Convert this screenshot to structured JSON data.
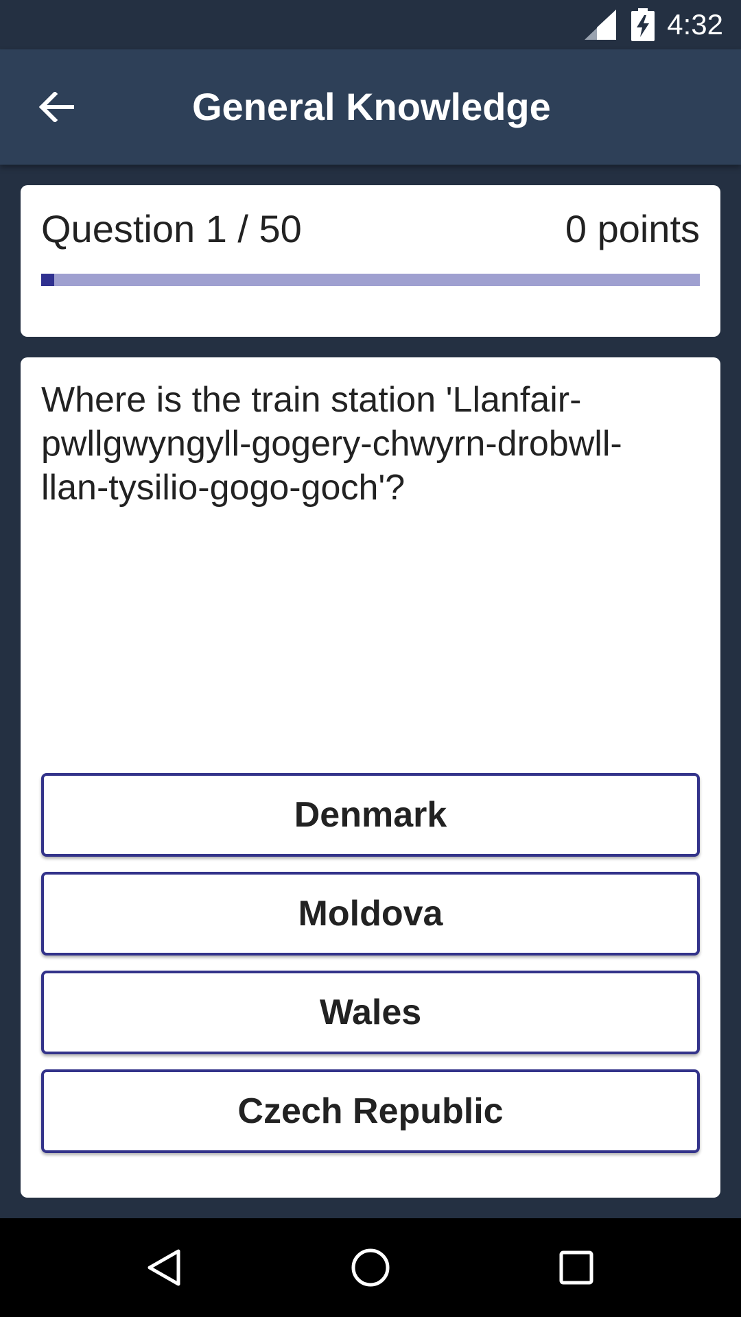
{
  "status_bar": {
    "time": "4:32",
    "icons": [
      "signal-icon",
      "battery-charging-icon"
    ]
  },
  "app_bar": {
    "title": "General Knowledge",
    "back_icon": "arrow-left-icon"
  },
  "progress": {
    "question_label": "Question 1 / 50",
    "points_label": "0 points",
    "current": 1,
    "total": 50,
    "fraction": 0.02
  },
  "question": {
    "text": "Where is the train station 'Llanfair-pwllgwyngyll-gogery-chwyrn-drobwll-llan-tysilio-gogo-goch'?"
  },
  "answers": [
    {
      "label": "Denmark"
    },
    {
      "label": "Moldova"
    },
    {
      "label": "Wales"
    },
    {
      "label": "Czech Republic"
    }
  ],
  "nav_bar": {
    "icons": [
      "back-triangle-icon",
      "home-circle-icon",
      "recents-square-icon"
    ]
  },
  "colors": {
    "status_bar": "#243042",
    "app_bar": "#2e4058",
    "accent": "#303190",
    "progress_track": "#9fa0d0",
    "answer_border": "#33338a"
  }
}
